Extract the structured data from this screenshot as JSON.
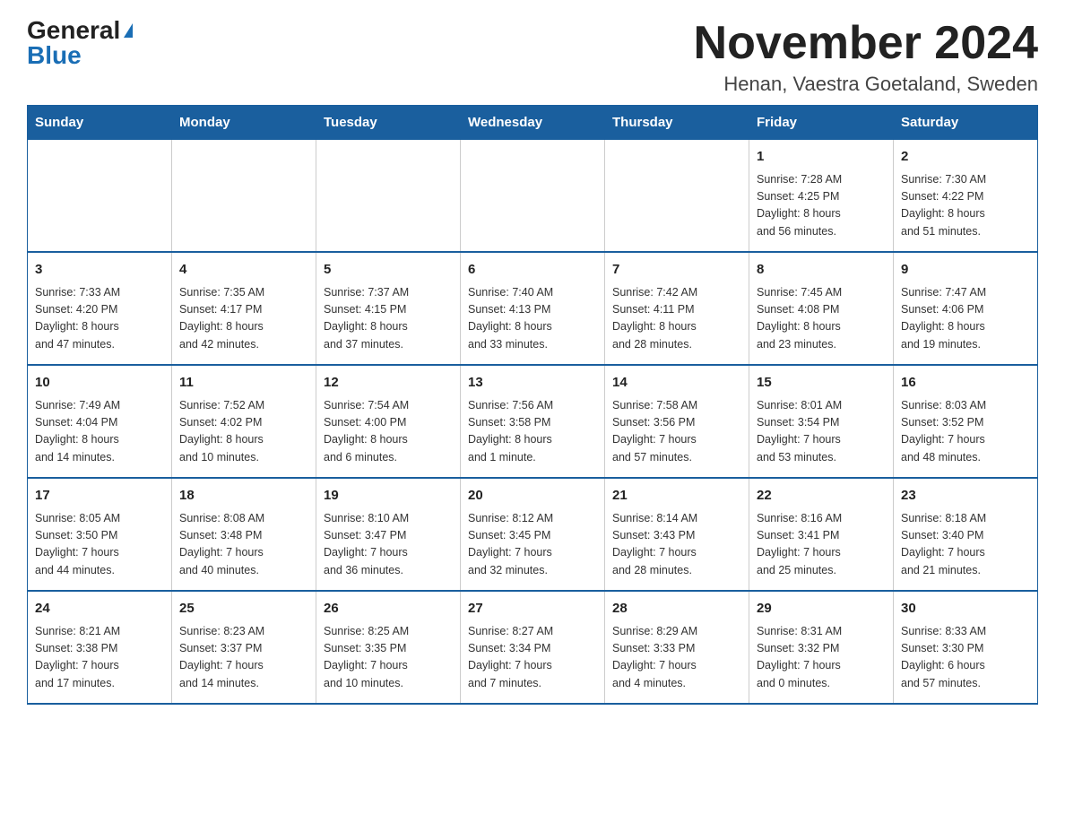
{
  "header": {
    "logo_general": "General",
    "logo_blue": "Blue",
    "month_title": "November 2024",
    "location": "Henan, Vaestra Goetaland, Sweden"
  },
  "weekdays": [
    "Sunday",
    "Monday",
    "Tuesday",
    "Wednesday",
    "Thursday",
    "Friday",
    "Saturday"
  ],
  "weeks": [
    {
      "days": [
        {
          "num": "",
          "info": ""
        },
        {
          "num": "",
          "info": ""
        },
        {
          "num": "",
          "info": ""
        },
        {
          "num": "",
          "info": ""
        },
        {
          "num": "",
          "info": ""
        },
        {
          "num": "1",
          "info": "Sunrise: 7:28 AM\nSunset: 4:25 PM\nDaylight: 8 hours\nand 56 minutes."
        },
        {
          "num": "2",
          "info": "Sunrise: 7:30 AM\nSunset: 4:22 PM\nDaylight: 8 hours\nand 51 minutes."
        }
      ]
    },
    {
      "days": [
        {
          "num": "3",
          "info": "Sunrise: 7:33 AM\nSunset: 4:20 PM\nDaylight: 8 hours\nand 47 minutes."
        },
        {
          "num": "4",
          "info": "Sunrise: 7:35 AM\nSunset: 4:17 PM\nDaylight: 8 hours\nand 42 minutes."
        },
        {
          "num": "5",
          "info": "Sunrise: 7:37 AM\nSunset: 4:15 PM\nDaylight: 8 hours\nand 37 minutes."
        },
        {
          "num": "6",
          "info": "Sunrise: 7:40 AM\nSunset: 4:13 PM\nDaylight: 8 hours\nand 33 minutes."
        },
        {
          "num": "7",
          "info": "Sunrise: 7:42 AM\nSunset: 4:11 PM\nDaylight: 8 hours\nand 28 minutes."
        },
        {
          "num": "8",
          "info": "Sunrise: 7:45 AM\nSunset: 4:08 PM\nDaylight: 8 hours\nand 23 minutes."
        },
        {
          "num": "9",
          "info": "Sunrise: 7:47 AM\nSunset: 4:06 PM\nDaylight: 8 hours\nand 19 minutes."
        }
      ]
    },
    {
      "days": [
        {
          "num": "10",
          "info": "Sunrise: 7:49 AM\nSunset: 4:04 PM\nDaylight: 8 hours\nand 14 minutes."
        },
        {
          "num": "11",
          "info": "Sunrise: 7:52 AM\nSunset: 4:02 PM\nDaylight: 8 hours\nand 10 minutes."
        },
        {
          "num": "12",
          "info": "Sunrise: 7:54 AM\nSunset: 4:00 PM\nDaylight: 8 hours\nand 6 minutes."
        },
        {
          "num": "13",
          "info": "Sunrise: 7:56 AM\nSunset: 3:58 PM\nDaylight: 8 hours\nand 1 minute."
        },
        {
          "num": "14",
          "info": "Sunrise: 7:58 AM\nSunset: 3:56 PM\nDaylight: 7 hours\nand 57 minutes."
        },
        {
          "num": "15",
          "info": "Sunrise: 8:01 AM\nSunset: 3:54 PM\nDaylight: 7 hours\nand 53 minutes."
        },
        {
          "num": "16",
          "info": "Sunrise: 8:03 AM\nSunset: 3:52 PM\nDaylight: 7 hours\nand 48 minutes."
        }
      ]
    },
    {
      "days": [
        {
          "num": "17",
          "info": "Sunrise: 8:05 AM\nSunset: 3:50 PM\nDaylight: 7 hours\nand 44 minutes."
        },
        {
          "num": "18",
          "info": "Sunrise: 8:08 AM\nSunset: 3:48 PM\nDaylight: 7 hours\nand 40 minutes."
        },
        {
          "num": "19",
          "info": "Sunrise: 8:10 AM\nSunset: 3:47 PM\nDaylight: 7 hours\nand 36 minutes."
        },
        {
          "num": "20",
          "info": "Sunrise: 8:12 AM\nSunset: 3:45 PM\nDaylight: 7 hours\nand 32 minutes."
        },
        {
          "num": "21",
          "info": "Sunrise: 8:14 AM\nSunset: 3:43 PM\nDaylight: 7 hours\nand 28 minutes."
        },
        {
          "num": "22",
          "info": "Sunrise: 8:16 AM\nSunset: 3:41 PM\nDaylight: 7 hours\nand 25 minutes."
        },
        {
          "num": "23",
          "info": "Sunrise: 8:18 AM\nSunset: 3:40 PM\nDaylight: 7 hours\nand 21 minutes."
        }
      ]
    },
    {
      "days": [
        {
          "num": "24",
          "info": "Sunrise: 8:21 AM\nSunset: 3:38 PM\nDaylight: 7 hours\nand 17 minutes."
        },
        {
          "num": "25",
          "info": "Sunrise: 8:23 AM\nSunset: 3:37 PM\nDaylight: 7 hours\nand 14 minutes."
        },
        {
          "num": "26",
          "info": "Sunrise: 8:25 AM\nSunset: 3:35 PM\nDaylight: 7 hours\nand 10 minutes."
        },
        {
          "num": "27",
          "info": "Sunrise: 8:27 AM\nSunset: 3:34 PM\nDaylight: 7 hours\nand 7 minutes."
        },
        {
          "num": "28",
          "info": "Sunrise: 8:29 AM\nSunset: 3:33 PM\nDaylight: 7 hours\nand 4 minutes."
        },
        {
          "num": "29",
          "info": "Sunrise: 8:31 AM\nSunset: 3:32 PM\nDaylight: 7 hours\nand 0 minutes."
        },
        {
          "num": "30",
          "info": "Sunrise: 8:33 AM\nSunset: 3:30 PM\nDaylight: 6 hours\nand 57 minutes."
        }
      ]
    }
  ]
}
